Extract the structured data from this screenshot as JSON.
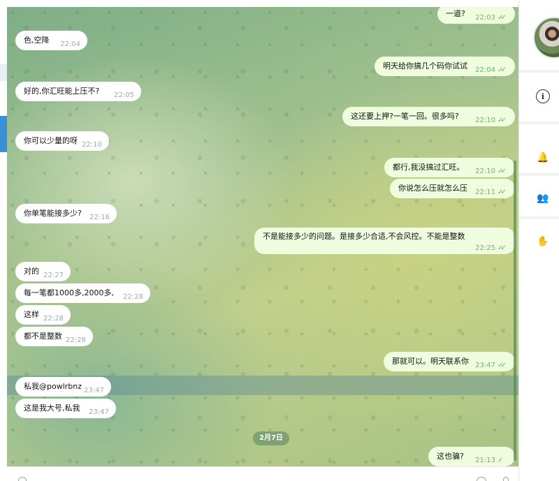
{
  "messages": [
    {
      "dir": "out",
      "text": "一道?",
      "time": "22:03",
      "read": true
    },
    {
      "dir": "in",
      "text": "色,空降",
      "time": "22:04"
    },
    {
      "dir": "out",
      "text": "明天给你搞几个码你试试",
      "time": "22:04",
      "read": true
    },
    {
      "dir": "in",
      "text": "好的,你汇旺能上压不?",
      "time": "22:05"
    },
    {
      "dir": "out",
      "text": "这还要上押?一笔一回。很多吗?",
      "time": "22:10",
      "read": true
    },
    {
      "dir": "in",
      "text": "你可以少量的呀",
      "time": "22:10"
    },
    {
      "dir": "out",
      "text": "都行,我没搞过汇旺。",
      "time": "22:10",
      "read": true
    },
    {
      "dir": "out",
      "text": "你说怎么压就怎么压",
      "time": "22:11",
      "read": true
    },
    {
      "dir": "in",
      "text": "你单笔能接多少?",
      "time": "22:16"
    },
    {
      "dir": "out",
      "text": "不是能接多少的问题。是接多少合适,不会风控。不能是整数",
      "time": "22:25",
      "read": true
    },
    {
      "dir": "in",
      "text": "对的",
      "time": "22:27"
    },
    {
      "dir": "in",
      "text": "每一笔都1000多,2000多,",
      "time": "22:28"
    },
    {
      "dir": "in",
      "text": "这样",
      "time": "22:28"
    },
    {
      "dir": "in",
      "text": "都不是整数",
      "time": "22:28"
    },
    {
      "dir": "out",
      "text": "那就可以。明天联系你",
      "time": "23:47",
      "read": true
    },
    {
      "dir": "in",
      "text": "私我@powlrbnz",
      "time": "23:47"
    },
    {
      "dir": "in",
      "text": "这是我大号,私我",
      "time": "23:47"
    },
    {
      "dir": "out",
      "text": "这也骗?",
      "time": "21:13",
      "read": false
    }
  ],
  "date_divider": "2月7日",
  "read_check": "✓✓",
  "sent_check": "✓",
  "right_panel": {
    "icons": [
      "info-icon",
      "bell-icon",
      "members-icon",
      "hand-icon"
    ],
    "info_glyph": "i",
    "bell_glyph": "🔔",
    "members_glyph": "👥",
    "hand_glyph": "✋"
  },
  "colors": {
    "incoming_bubble": "#ffffff",
    "outgoing_bubble": "#effdde",
    "check_green": "#5fb35f",
    "hand_red": "#e04848"
  }
}
